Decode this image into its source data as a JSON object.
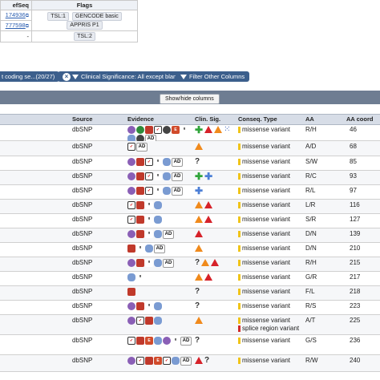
{
  "top_table": {
    "col_refseq": "efSeq",
    "col_flags": "Flags",
    "rows": [
      {
        "refseq": "174936",
        "flags": [
          "TSL:1",
          "GENCODE basic",
          "APPRIS P1"
        ]
      },
      {
        "refseq": "777598",
        "flags": []
      },
      {
        "refseq": "-",
        "flags": [
          "TSL:2"
        ]
      }
    ]
  },
  "filters": {
    "coding": "t coding se...(20/27)",
    "clinical": "Clinical Significance: All except blank",
    "other": "Filter Other Columns"
  },
  "showhide_label": "Show/hide columns",
  "headers": {
    "source": "Source",
    "evidence": "Evidence",
    "clin": "Clin. Sig.",
    "conseq": "Conseq. Type",
    "aa": "AA",
    "aa_coord": "AA coord"
  },
  "rows": [
    {
      "source": "dbSNP",
      "evidence": [
        "phen",
        "hm",
        "flag",
        "cite",
        "cs",
        "exac",
        "gnomad",
        "pub",
        "cs",
        "ad"
      ],
      "clin": [
        "plus-g",
        "warn-red",
        "warn",
        "dots"
      ],
      "conseq": [
        "missense variant"
      ],
      "aa": "R/H",
      "coord": "46"
    },
    {
      "source": "dbSNP",
      "evidence": [
        "cite",
        "ad"
      ],
      "clin": [
        "warn"
      ],
      "conseq": [
        "missense variant"
      ],
      "aa": "A/D",
      "coord": "68"
    },
    {
      "source": "dbSNP",
      "evidence": [
        "phen",
        "flag",
        "cite",
        "gnomad",
        "pub",
        "ad"
      ],
      "clin": [
        "q"
      ],
      "conseq": [
        "missense variant"
      ],
      "aa": "S/W",
      "coord": "85"
    },
    {
      "source": "dbSNP",
      "evidence": [
        "phen",
        "flag",
        "cite",
        "gnomad",
        "pub",
        "ad"
      ],
      "clin": [
        "plus-g",
        "plus-b"
      ],
      "conseq": [
        "missense variant"
      ],
      "aa": "R/C",
      "coord": "93"
    },
    {
      "source": "dbSNP",
      "evidence": [
        "phen",
        "flag",
        "cite",
        "gnomad",
        "pub",
        "ad"
      ],
      "clin": [
        "plus-b"
      ],
      "conseq": [
        "missense variant"
      ],
      "aa": "R/L",
      "coord": "97"
    },
    {
      "source": "dbSNP",
      "evidence": [
        "cite",
        "flag",
        "gnomad",
        "pub"
      ],
      "clin": [
        "warn",
        "warn-red"
      ],
      "conseq": [
        "missense variant"
      ],
      "aa": "L/R",
      "coord": "116"
    },
    {
      "source": "dbSNP",
      "evidence": [
        "cite",
        "flag",
        "gnomad",
        "pub"
      ],
      "clin": [
        "warn",
        "warn-red"
      ],
      "conseq": [
        "missense variant"
      ],
      "aa": "S/R",
      "coord": "127"
    },
    {
      "source": "dbSNP",
      "evidence": [
        "phen",
        "flag",
        "gnomad",
        "pub",
        "ad"
      ],
      "clin": [
        "warn-red"
      ],
      "conseq": [
        "missense variant"
      ],
      "aa": "D/N",
      "coord": "139"
    },
    {
      "source": "dbSNP",
      "evidence": [
        "flag",
        "gnomad",
        "pub",
        "ad"
      ],
      "clin": [
        "warn"
      ],
      "conseq": [
        "missense variant"
      ],
      "aa": "D/N",
      "coord": "210"
    },
    {
      "source": "dbSNP",
      "evidence": [
        "phen",
        "flag",
        "gnomad",
        "pub",
        "ad"
      ],
      "clin": [
        "q",
        "warn",
        "warn-red"
      ],
      "conseq": [
        "missense variant"
      ],
      "aa": "R/H",
      "coord": "215"
    },
    {
      "source": "dbSNP",
      "evidence": [
        "pub",
        "gnomad"
      ],
      "clin": [
        "warn",
        "warn-red"
      ],
      "conseq": [
        "missense variant"
      ],
      "aa": "G/R",
      "coord": "217"
    },
    {
      "source": "dbSNP",
      "evidence": [
        "flag"
      ],
      "clin": [
        "q"
      ],
      "conseq": [
        "missense variant"
      ],
      "aa": "F/L",
      "coord": "218"
    },
    {
      "source": "dbSNP",
      "evidence": [
        "phen",
        "flag",
        "gnomad",
        "pub"
      ],
      "clin": [
        "q"
      ],
      "conseq": [
        "missense variant"
      ],
      "aa": "R/S",
      "coord": "223"
    },
    {
      "source": "dbSNP",
      "evidence": [
        "phen",
        "cite",
        "flag",
        "pub"
      ],
      "clin": [
        "warn"
      ],
      "conseq": [
        "missense variant",
        "splice region variant"
      ],
      "aa": "A/T",
      "coord": "225"
    },
    {
      "source": "dbSNP",
      "evidence": [
        "cite",
        "flag",
        "ex",
        "pub",
        "phen",
        "gnomad",
        "ad"
      ],
      "clin": [
        "q"
      ],
      "conseq": [
        "missense variant"
      ],
      "aa": "G/S",
      "coord": "236"
    },
    {
      "source": "dbSNP",
      "evidence": [
        "phen",
        "cite",
        "flag",
        "ex",
        "cite",
        "pub",
        "ad"
      ],
      "clin": [
        "warn-red",
        "q"
      ],
      "conseq": [
        "missense variant"
      ],
      "aa": "R/W",
      "coord": "240"
    }
  ]
}
